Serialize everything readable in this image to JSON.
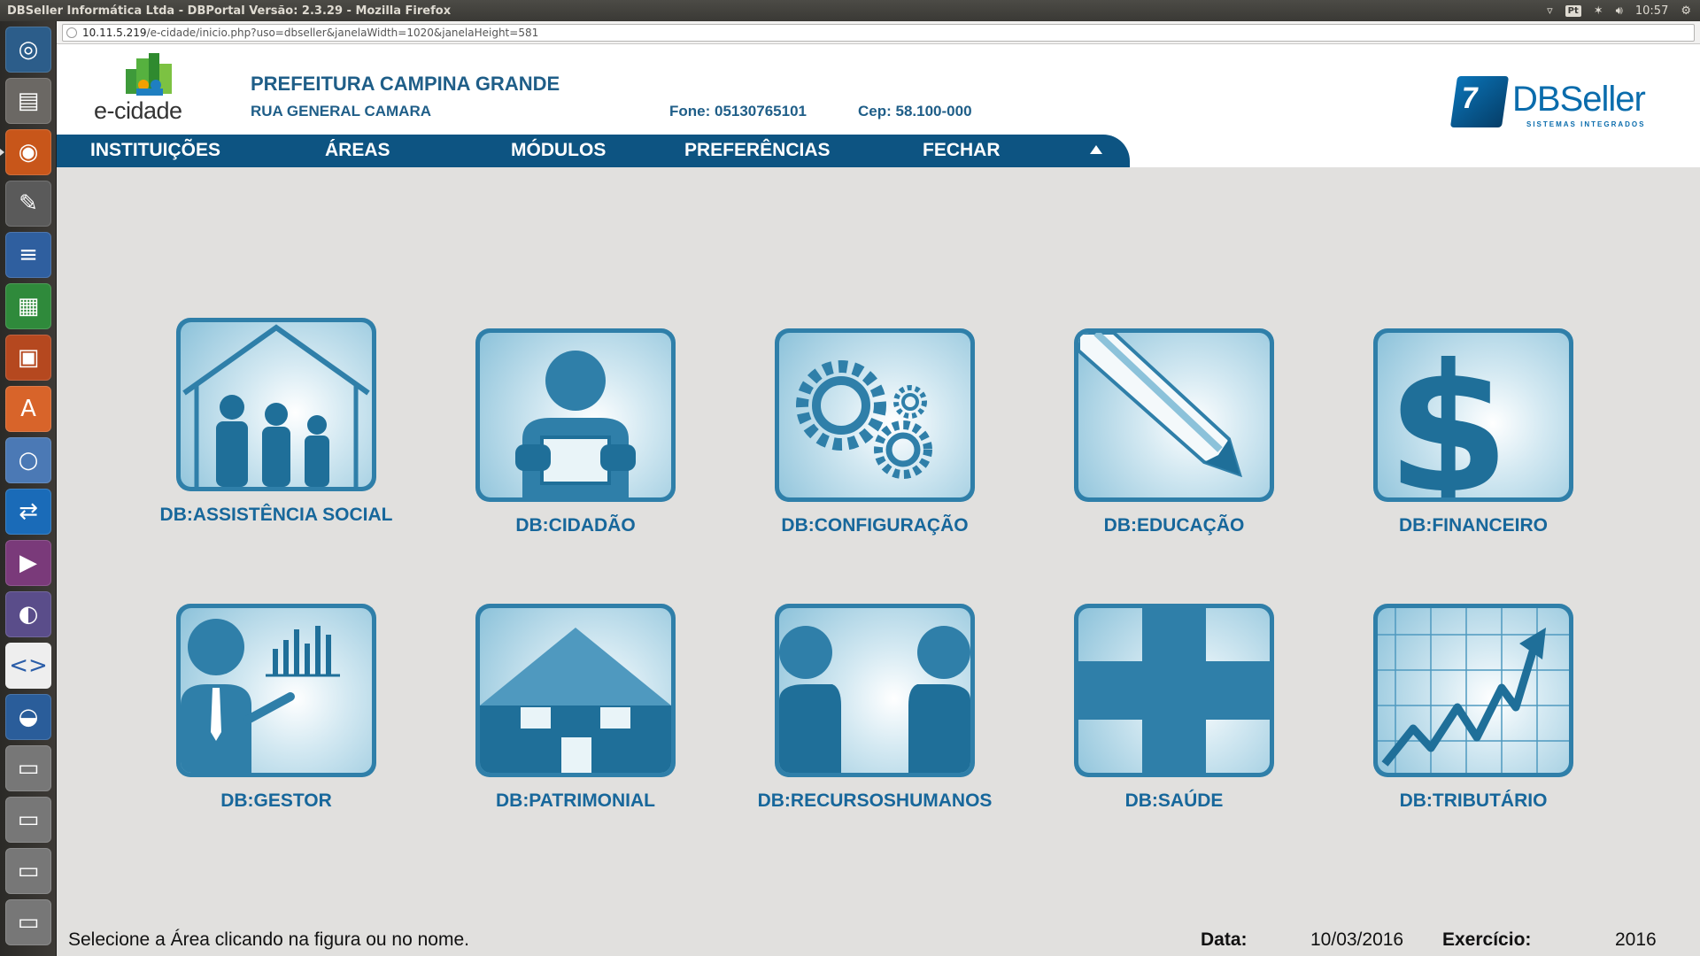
{
  "window": {
    "title": "DBSeller Informática Ltda - DBPortal Versão: 2.3.29 - Mozilla Firefox",
    "clock": "10:57",
    "keyboard_layout": "Pt"
  },
  "browser": {
    "url_host": "10.11.5.219",
    "url_path": "/e-cidade/inicio.php?uso=dbseller&janelaWidth=1020&janelaHeight=581"
  },
  "header": {
    "logo_text": "e-cidade",
    "org_name": "PREFEITURA CAMPINA GRANDE",
    "street": "RUA GENERAL CAMARA",
    "phone": "Fone: 05130765101",
    "cep": "Cep: 58.100-000",
    "vendor_logo": "DBSeller",
    "vendor_tagline": "SISTEMAS INTEGRADOS"
  },
  "menu": {
    "items": [
      "INSTITUIÇÕES",
      "ÁREAS",
      "MÓDULOS",
      "PREFERÊNCIAS",
      "FECHAR"
    ]
  },
  "modules": [
    {
      "label": "DB:ASSISTÊNCIA SOCIAL",
      "icon": "family-house-icon"
    },
    {
      "label": "DB:CIDADÃO",
      "icon": "citizen-icon"
    },
    {
      "label": "DB:CONFIGURAÇÃO",
      "icon": "gears-icon"
    },
    {
      "label": "DB:EDUCAÇÃO",
      "icon": "pencil-icon"
    },
    {
      "label": "DB:FINANCEIRO",
      "icon": "dollar-icon"
    },
    {
      "label": "DB:GESTOR",
      "icon": "manager-chart-icon"
    },
    {
      "label": "DB:PATRIMONIAL",
      "icon": "building-icon"
    },
    {
      "label": "DB:RECURSOSHUMANOS",
      "icon": "people-icon"
    },
    {
      "label": "DB:SAÚDE",
      "icon": "health-cross-icon"
    },
    {
      "label": "DB:TRIBUTÁRIO",
      "icon": "growth-chart-icon"
    }
  ],
  "footer": {
    "hint": "Selecione a Área clicando na figura ou no nome.",
    "date_label": "Data:",
    "date_value": "10/03/2016",
    "year_label": "Exercício:",
    "year_value": "2016"
  },
  "colors": {
    "brand_blue": "#0d5482",
    "label_blue": "#17679b",
    "tile_blue": "#2f7fa9"
  }
}
